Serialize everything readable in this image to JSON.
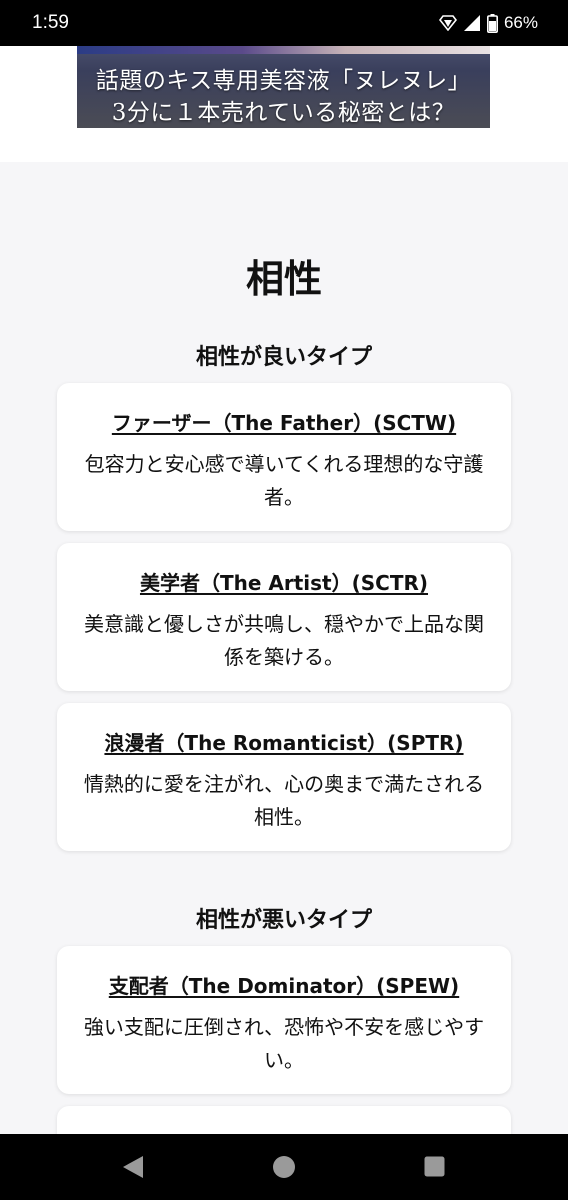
{
  "status_bar": {
    "time": "1:59",
    "battery": "66%",
    "icons": [
      "signal-diamond-icon",
      "cell-signal-icon",
      "battery-icon"
    ]
  },
  "ad": {
    "line1": "話題のキス専用美容液「ヌレヌレ」",
    "line2": "3分に１本売れている秘密とは？"
  },
  "section": {
    "title": "相性",
    "good_heading": "相性が良いタイプ",
    "bad_heading": "相性が悪いタイプ"
  },
  "good_types": [
    {
      "title": "ファーザー（The Father）(SCTW)",
      "description": "包容力と安心感で導いてくれる理想的な守護者。"
    },
    {
      "title": "美学者（The Artist）(SCTR)",
      "description": "美意識と優しさが共鳴し、穏やかで上品な関係を築ける。"
    },
    {
      "title": "浪漫者（The Romanticist）(SPTR)",
      "description": "情熱的に愛を注がれ、心の奥まで満たされる相性。"
    }
  ],
  "bad_types": [
    {
      "title": "支配者（The Dominator）(SPEW)",
      "description": "強い支配に圧倒され、恐怖や不安を感じやすい。"
    }
  ],
  "nav_bar": {
    "icons": [
      "back-icon",
      "home-icon",
      "recents-icon"
    ]
  },
  "colors": {
    "page_background": "#f6f6f8",
    "card_background": "#ffffff",
    "text": "#111111",
    "system_bars": "#000000"
  }
}
